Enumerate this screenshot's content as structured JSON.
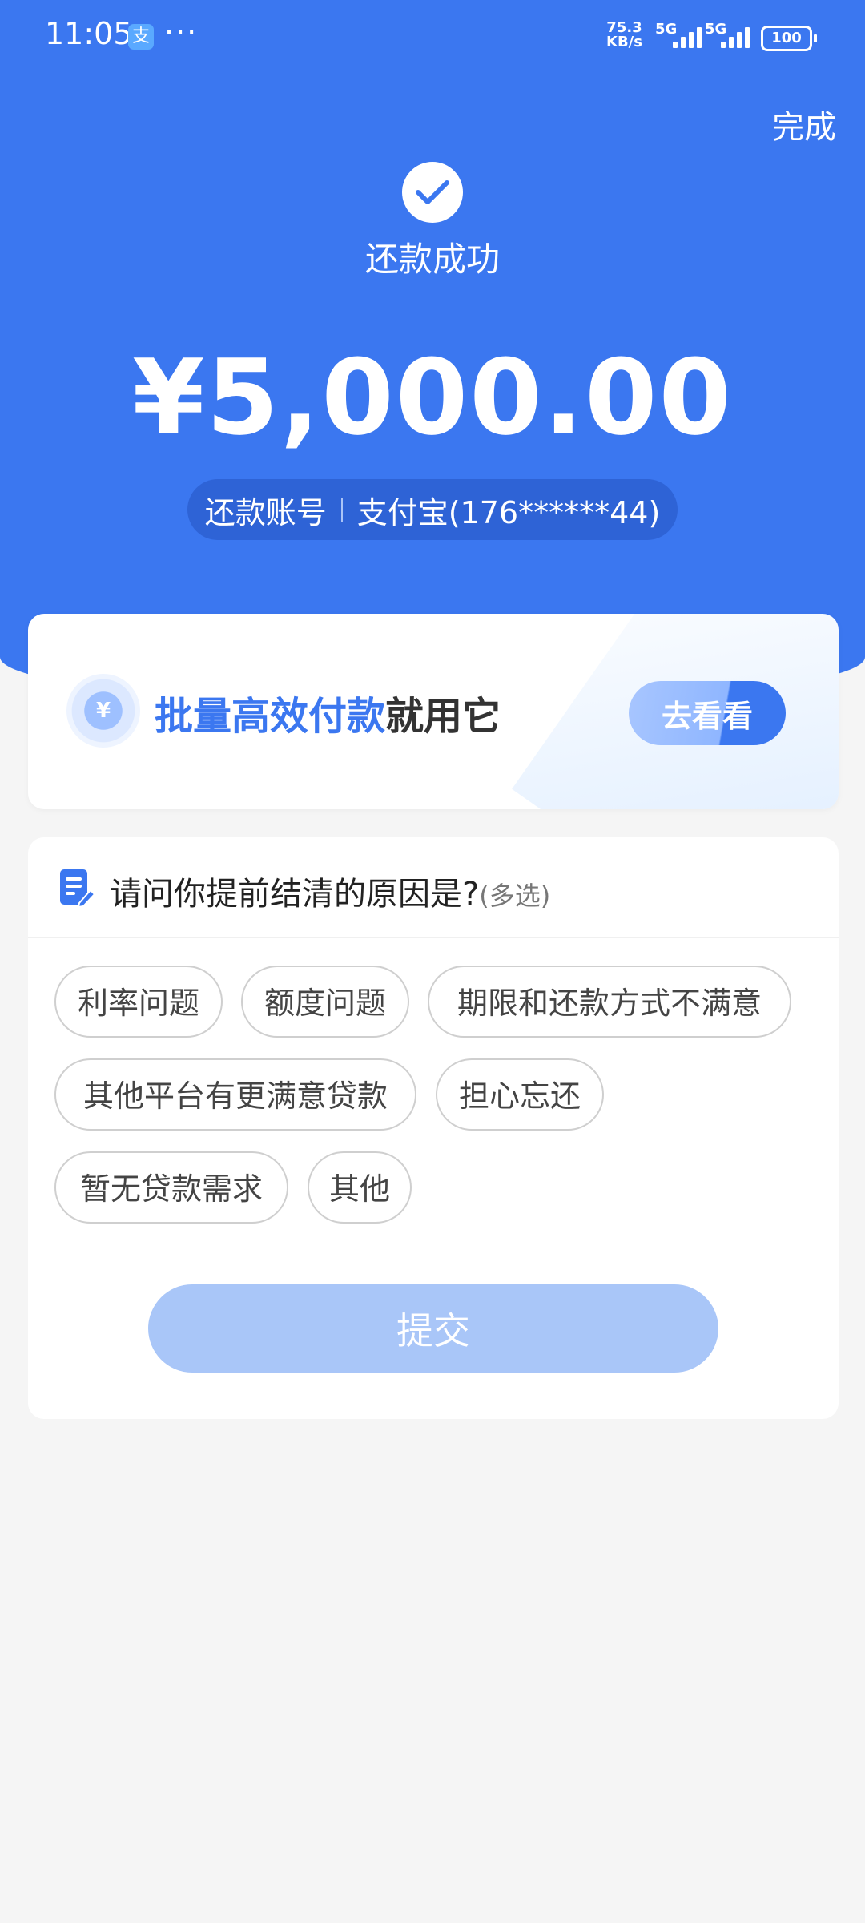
{
  "status_bar": {
    "time": "11:05",
    "app_icon_glyph": "支",
    "dots": "···",
    "speed_value": "75.3",
    "speed_unit": "KB/s",
    "net1": "5G",
    "net2": "5G",
    "battery": "100"
  },
  "header": {
    "done_label": "完成",
    "success_text": "还款成功",
    "amount": "¥5,000.00",
    "account_label": "还款账号",
    "account_value": "支付宝(176******44)"
  },
  "promo": {
    "coin_symbol": "¥",
    "highlight_text": "批量高效付款",
    "rest_text": "就用它",
    "button_label": "去看看"
  },
  "survey": {
    "title": "请问你提前结清的原因是?",
    "multi_label": "(多选)",
    "options": [
      "利率问题",
      "额度问题",
      "期限和还款方式不满意",
      "其他平台有更满意贷款",
      "担心忘还",
      "暂无贷款需求",
      "其他"
    ],
    "submit_label": "提交"
  },
  "colors": {
    "primary": "#3b77f0",
    "submit_disabled": "#a9c6f8"
  }
}
